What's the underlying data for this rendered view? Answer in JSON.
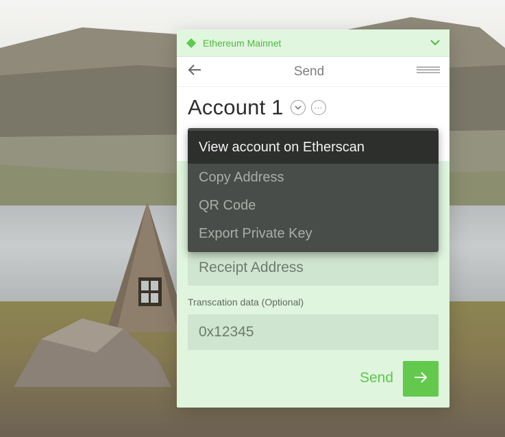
{
  "network": {
    "label": "Ethereum Mainnet",
    "accent": "#5ccb4b"
  },
  "nav": {
    "title": "Send"
  },
  "account": {
    "name": "Account 1"
  },
  "menu": {
    "items": [
      {
        "label": "View account on Etherscan"
      },
      {
        "label": "Copy Address"
      },
      {
        "label": "QR Code"
      },
      {
        "label": "Export Private Key"
      }
    ]
  },
  "form": {
    "receipt_placeholder": "Receipt Address",
    "data_label": "Transcation data (Optional)",
    "data_value": "0x12345",
    "send_label": "Send"
  },
  "icons": [
    "network-diamond-icon",
    "chevron-down-icon",
    "back-arrow-icon",
    "menu-icon",
    "chevron-down-circle-icon",
    "more-dots-icon",
    "arrow-right-icon"
  ]
}
